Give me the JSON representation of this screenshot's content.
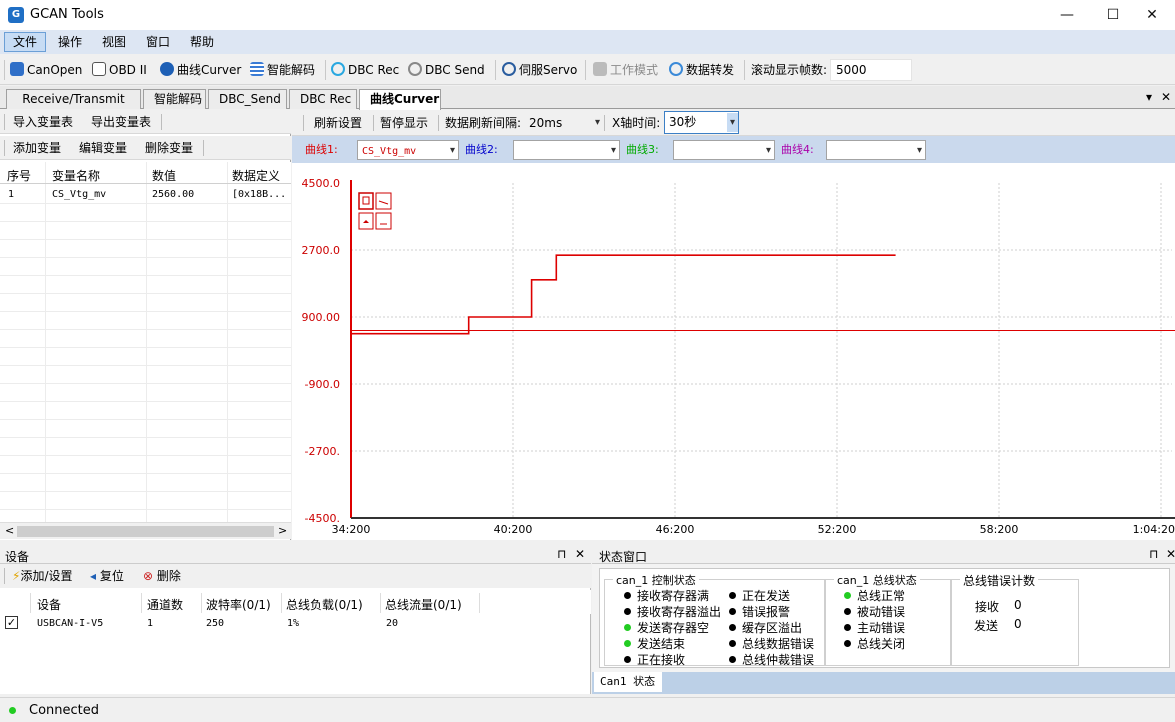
{
  "window": {
    "title": "GCAN Tools",
    "minimize_glyph": "—",
    "maximize_glyph": "☐",
    "close_glyph": "✕"
  },
  "menu": {
    "file": "文件",
    "operate": "操作",
    "view": "视图",
    "window": "窗口",
    "help": "帮助"
  },
  "toolbar": {
    "canopen": "CanOpen",
    "obd": "OBD II",
    "curver": "曲线Curver",
    "decode": "智能解码",
    "dbc_rec": "DBC Rec",
    "dbc_send": "DBC Send",
    "servo": "伺服Servo",
    "work_mode": "工作模式",
    "forward": "数据转发",
    "frames_label": "滚动显示帧数:",
    "frames_value": "5000"
  },
  "tabs": [
    "Receive/Transmit",
    "智能解码",
    "DBC_Send",
    "DBC Rec",
    "曲线Curver"
  ],
  "tab_controls": {
    "dropdown": "▾",
    "close": "✕"
  },
  "left": {
    "import": "导入变量表",
    "export": "导出变量表",
    "add": "添加变量",
    "edit": "编辑变量",
    "delete": "删除变量",
    "columns": [
      "序号",
      "变量名称",
      "数值",
      "数据定义"
    ],
    "rows": [
      [
        "1",
        "CS_Vtg_mv",
        "2560.00",
        "[0x18B..."
      ]
    ],
    "scroll_left": "<",
    "scroll_right": ">"
  },
  "chart_ctl": {
    "refresh": "刷新设置",
    "pause": "暂停显示",
    "interval_label": "数据刷新间隔:",
    "interval_value": "20ms",
    "xaxis_label": "X轴时间:",
    "xaxis_value": "30秒",
    "curve1_label": "曲线1:",
    "curve1_value": "CS_Vtg_mv",
    "curve2_label": "曲线2:",
    "curve3_label": "曲线3:",
    "curve4_label": "曲线4:",
    "colors": {
      "curve1": "#dd0000",
      "curve2": "#0000cc",
      "curve3": "#00aa00",
      "curve4": "#aa00aa"
    }
  },
  "chart_data": {
    "type": "line",
    "y_ticks": [
      "4500.0",
      "2700.0",
      "900.00",
      "-900.0",
      "-2700.",
      "-4500."
    ],
    "x_ticks": [
      "34:200",
      "40:200",
      "46:200",
      "52:200",
      "58:200",
      "1:04:20"
    ],
    "ylim": [
      -4500,
      4500
    ],
    "grid": true,
    "series": [
      {
        "color": "#dd0000",
        "points": [
          [
            34.2,
            450
          ],
          [
            38.5,
            450
          ],
          [
            38.5,
            900
          ],
          [
            40.8,
            900
          ],
          [
            40.8,
            1900
          ],
          [
            41.7,
            1900
          ],
          [
            41.7,
            2560
          ],
          [
            54.1,
            2560
          ]
        ]
      }
    ],
    "reference_line": {
      "value": 0,
      "color": "#dd0000"
    }
  },
  "devices": {
    "title": "设备",
    "pin": "⊓",
    "close": "✕",
    "add": "添加/设置",
    "reset": "复位",
    "delete": "删除",
    "columns": [
      "设备",
      "通道数",
      "波特率(0/1)",
      "总线负载(0/1)",
      "总线流量(0/1)"
    ],
    "rows": [
      {
        "checked": "✓",
        "name": "USBCAN-I-V5",
        "channels": "1",
        "baud": "250",
        "load": "1%",
        "traffic": "20"
      }
    ]
  },
  "status": {
    "title": "状态窗口",
    "pin": "⊓",
    "close": "✕",
    "ctrl_title": "can_1 控制状态",
    "ctrl_col1": [
      "接收寄存器满",
      "接收寄存器溢出",
      "发送寄存器空",
      "发送结束",
      "正在接收"
    ],
    "ctrl_col1_colors": [
      "#000000",
      "#000000",
      "#22cc22",
      "#22cc22",
      "#000000"
    ],
    "ctrl_col2": [
      "正在发送",
      "错误报警",
      "缓存区溢出",
      "总线数据错误",
      "总线仲裁错误"
    ],
    "bus_title": "can_1 总线状态",
    "bus_items": [
      "总线正常",
      "被动错误",
      "主动错误",
      "总线关闭"
    ],
    "bus_colors": [
      "#22cc22",
      "#000000",
      "#000000",
      "#000000"
    ],
    "err_title": "总线错误计数",
    "rx_label": "接收",
    "rx_value": "0",
    "tx_label": "发送",
    "tx_value": "0",
    "tab": "Can1 状态"
  },
  "statusbar": {
    "text": "Connected",
    "color": "#22cc22"
  }
}
